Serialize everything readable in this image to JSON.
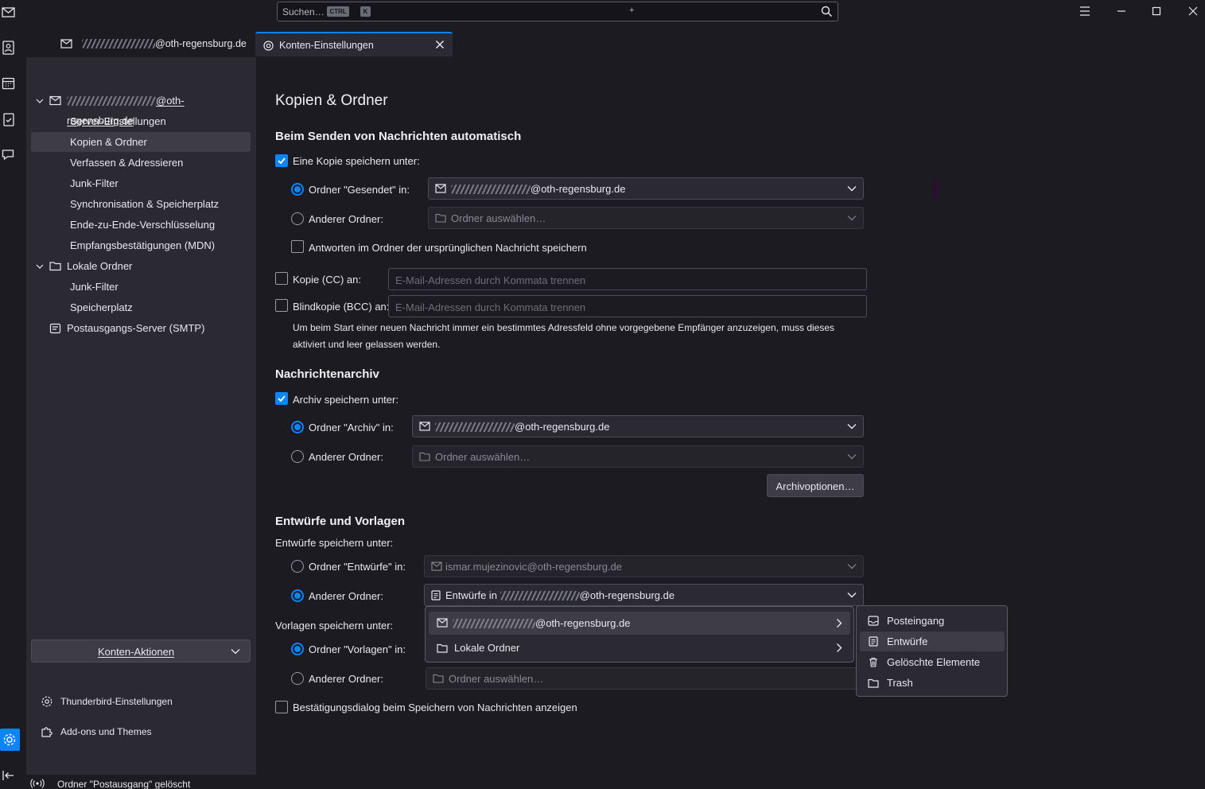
{
  "titlebar": {
    "search_placeholder": "Suchen…",
    "kbd_ctrl": "CTRL",
    "kbd_plus": "+",
    "kbd_k": "K"
  },
  "tabs": [
    {
      "label": "@oth-regensburg.de",
      "icon": "mail-account-icon"
    },
    {
      "label": "Konten-Einstellungen",
      "icon": "settings-icon",
      "active": true
    }
  ],
  "sidebar": {
    "account_label": "@oth-regensburg.de",
    "items": [
      "Server-Einstellungen",
      "Kopien & Ordner",
      "Verfassen & Adressieren",
      "Junk-Filter",
      "Synchronisation & Speicherplatz",
      "Ende-zu-Ende-Verschlüsselung",
      "Empfangsbestätigungen (MDN)"
    ],
    "local_folders": "Lokale Ordner",
    "local_items": [
      "Junk-Filter",
      "Speicherplatz"
    ],
    "smtp": "Postausgangs-Server (SMTP)",
    "account_actions": "Konten-Aktionen",
    "footer": [
      "Thunderbird-Einstellungen",
      "Add-ons und Themes"
    ]
  },
  "status": "Ordner \"Postausgang\" gelöscht",
  "main": {
    "title": "Kopien & Ordner",
    "send": {
      "heading": "Beim Senden von Nachrichten automatisch",
      "save_copy": "Eine Kopie speichern unter:",
      "sent_folder": "Ordner \"Gesendet\" in:",
      "sent_value": "@oth-regensburg.de",
      "other_folder": "Anderer Ordner:",
      "choose_folder": "Ordner auswählen…",
      "reply_in_folder": "Antworten im Ordner der ursprünglichen Nachricht speichern",
      "cc": "Kopie (CC) an:",
      "bcc": "Blindkopie (BCC) an:",
      "address_placeholder": "E-Mail-Adressen durch Kommata trennen",
      "hint": "Um beim Start einer neuen Nachricht immer ein bestimmtes Adressfeld ohne vorgegebene Empfänger anzuzeigen, muss dieses aktiviert und leer gelassen werden."
    },
    "archive": {
      "heading": "Nachrichtenarchiv",
      "save": "Archiv speichern unter:",
      "folder": "Ordner \"Archiv\" in:",
      "value": "@oth-regensburg.de",
      "other_folder": "Anderer Ordner:",
      "choose_folder": "Ordner auswählen…",
      "options_button": "Archivoptionen…"
    },
    "drafts": {
      "heading": "Entwürfe und Vorlagen",
      "drafts_label": "Entwürfe speichern unter:",
      "drafts_folder": "Ordner \"Entwürfe\" in:",
      "drafts_value": "ismar.mujezinovic@oth-regensburg.de",
      "other_folder": "Anderer Ordner:",
      "other_value_prefix": "Entwürfe in",
      "other_value_suffix": "@oth-regensburg.de",
      "templates_label": "Vorlagen speichern unter:",
      "templates_folder": "Ordner \"Vorlagen\" in:",
      "templates_other": "Anderer Ordner:",
      "choose_folder": "Ordner auswählen…",
      "confirm_dialog": "Bestätigungsdialog beim Speichern von Nachrichten anzeigen"
    }
  },
  "menu1": [
    {
      "label": "@oth-regensburg.de",
      "icon": "mail-account-icon"
    },
    {
      "label": "Lokale Ordner",
      "icon": "folder-icon"
    }
  ],
  "menu2": [
    {
      "label": "Posteingang",
      "icon": "inbox-icon"
    },
    {
      "label": "Entwürfe",
      "icon": "draft-icon",
      "highlighted": true
    },
    {
      "label": "Gelöschte Elemente",
      "icon": "trash-icon"
    },
    {
      "label": "Trash",
      "icon": "folder-icon"
    }
  ],
  "colors": {
    "accent": "#0a84ff",
    "background": "#1c1b22",
    "panel": "#2b2a33"
  }
}
